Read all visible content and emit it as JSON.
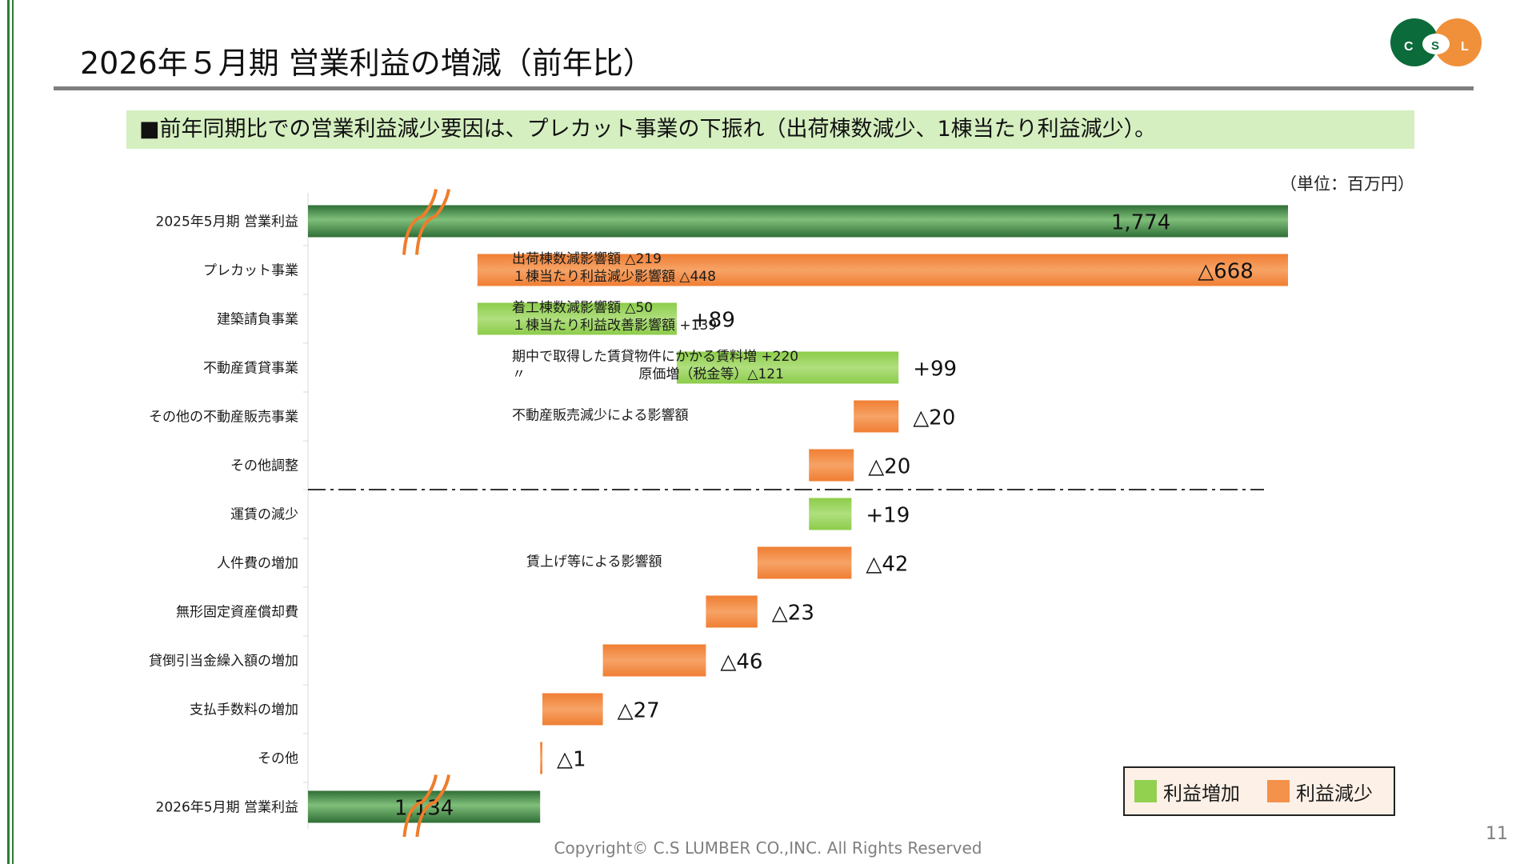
{
  "title": "2026年５月期 営業利益の増減（前年比）",
  "headline": "■前年同期比での営業利益減少要因は、プレカット事業の下振れ（出荷棟数減少、1棟当たり利益減少）。",
  "logo": {
    "left": "C",
    "middle": "S",
    "right": "L",
    "colors": {
      "green": "#0b6b3a",
      "orange": "#f0903a"
    }
  },
  "footer": "Copyright©  C.S  LUMBER  CO.,INC. All Rights Reserved",
  "page_number": "11",
  "colors": {
    "increase": "#92d050",
    "decrease": "#f4914a",
    "total": "#3d8a45",
    "break": "#ef7d2b",
    "divider": "#333333"
  },
  "chart_data": {
    "type": "bar",
    "subtype": "waterfall-horizontal",
    "unit": "（単位：百万円）",
    "categories": [
      "2025年5月期 営業利益",
      "プレカット事業",
      "建築請負事業",
      "不動産賃貸事業",
      "その他の不動産販売事業",
      "その他調整",
      "運賃の減少",
      "人件費の増加",
      "無形固定資産償却費",
      "貸倒引当金繰入額の増加",
      "支払手数料の増加",
      "その他",
      "2026年5月期 営業利益"
    ],
    "values": [
      1774,
      -668,
      89,
      99,
      -20,
      -20,
      19,
      -42,
      -23,
      -46,
      -27,
      -1,
      1134
    ],
    "kinds": [
      "total",
      "change",
      "change",
      "change",
      "change",
      "change",
      "change",
      "change",
      "change",
      "change",
      "change",
      "change",
      "total"
    ],
    "value_labels": [
      "1,774",
      "△668",
      "+89",
      "+99",
      "△20",
      "△20",
      "+19",
      "△42",
      "△23",
      "△46",
      "△27",
      "△1",
      "1,134"
    ],
    "annotations": [
      {
        "row": 1,
        "lines": [
          "出荷棟数減影響額 △219",
          "１棟当たり利益減少影響額 △448"
        ]
      },
      {
        "row": 2,
        "lines": [
          "着工棟数減影響額 △50",
          "１棟当たり利益改善影響額 +139"
        ]
      },
      {
        "row": 3,
        "lines": [
          "期中で取得した賃貸物件にかかる賃料増 +220",
          "〃　　　　　　　　 原価増（税金等）△121"
        ]
      },
      {
        "row": 4,
        "lines": [
          "不動産販売減少による影響額"
        ]
      },
      {
        "row": 7,
        "lines": [
          "賃上げ等による影響額"
        ]
      }
    ],
    "divider_after_row": 5,
    "axis_break_value": 1050,
    "xlim": [
      1000,
      1800
    ],
    "legend": {
      "position": "bottom-right",
      "increase": "利益増加",
      "decrease": "利益減少"
    }
  }
}
